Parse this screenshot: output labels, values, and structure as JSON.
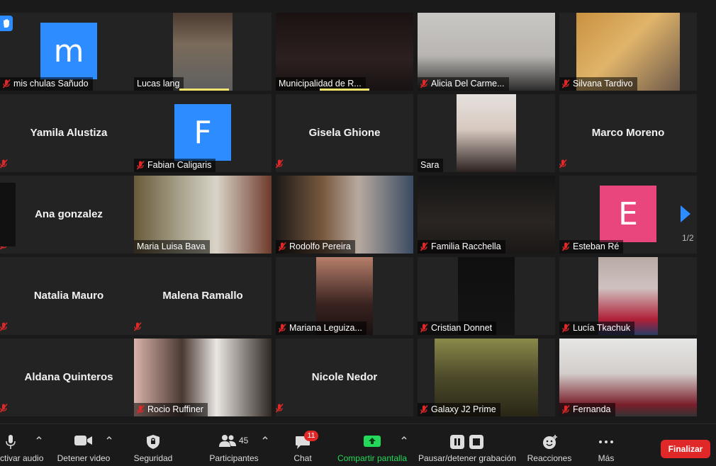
{
  "tiles": [
    {
      "name": "mis chulas Sañudo",
      "type": "avatar",
      "letter": "m",
      "color": "#2d8cff",
      "muted": true
    },
    {
      "name": "Lucas lang",
      "type": "video",
      "muted": false
    },
    {
      "name": "Municipalidad de R...",
      "type": "video",
      "muted": false
    },
    {
      "name": "Alicia Del Carme...",
      "type": "video",
      "muted": true
    },
    {
      "name": "Silvana Tardivo",
      "type": "video",
      "muted": true
    },
    {
      "name": "Yamila Alustiza",
      "type": "name",
      "muted": true
    },
    {
      "name": "Fabian Caligaris",
      "type": "avatar",
      "letter": "F",
      "color": "#2d8cff",
      "muted": true
    },
    {
      "name": "Gisela Ghione",
      "type": "name",
      "muted": true
    },
    {
      "name": "Sara",
      "type": "video",
      "muted": false
    },
    {
      "name": "Marco Moreno",
      "type": "name",
      "muted": true
    },
    {
      "name": "Ana gonzalez",
      "type": "name",
      "muted": true
    },
    {
      "name": "Maria Luisa Bava",
      "type": "video",
      "muted": false,
      "active": true
    },
    {
      "name": "Rodolfo Pereira",
      "type": "video",
      "muted": true
    },
    {
      "name": "Familia Racchella",
      "type": "video",
      "muted": true
    },
    {
      "name": "Esteban Ré",
      "type": "avatar",
      "letter": "E",
      "color": "#e8467c",
      "muted": true
    },
    {
      "name": "Natalia Mauro",
      "type": "name",
      "muted": true
    },
    {
      "name": "Malena Ramallo",
      "type": "name",
      "muted": true
    },
    {
      "name": "Mariana Leguiza...",
      "type": "video",
      "muted": true
    },
    {
      "name": "Cristian Donnet",
      "type": "video",
      "muted": true
    },
    {
      "name": "Lucía Tkachuk",
      "type": "video",
      "muted": true
    },
    {
      "name": "Aldana Quinteros",
      "type": "name",
      "muted": true
    },
    {
      "name": "Rocio Ruffiner",
      "type": "video",
      "muted": true
    },
    {
      "name": "Nicole Nedor",
      "type": "name",
      "muted": true
    },
    {
      "name": "Galaxy J2 Prime",
      "type": "video",
      "muted": true
    },
    {
      "name": "Fernanda",
      "type": "video",
      "muted": true
    }
  ],
  "pager": {
    "label": "1/2"
  },
  "toolbar": {
    "audio_label": "ctivar audio",
    "video_label": "Detener video",
    "security_label": "Seguridad",
    "participants_label": "Participantes",
    "participants_count": "45",
    "chat_label": "Chat",
    "chat_badge": "11",
    "share_label": "Compartir pantalla",
    "record_label": "Pausar/detener grabación",
    "reactions_label": "Reacciones",
    "more_label": "Más",
    "end_label": "Finalizar"
  },
  "colors": {
    "share_green": "#23d959",
    "end_red": "#e02828",
    "active_speaker": "#d6e06a"
  }
}
